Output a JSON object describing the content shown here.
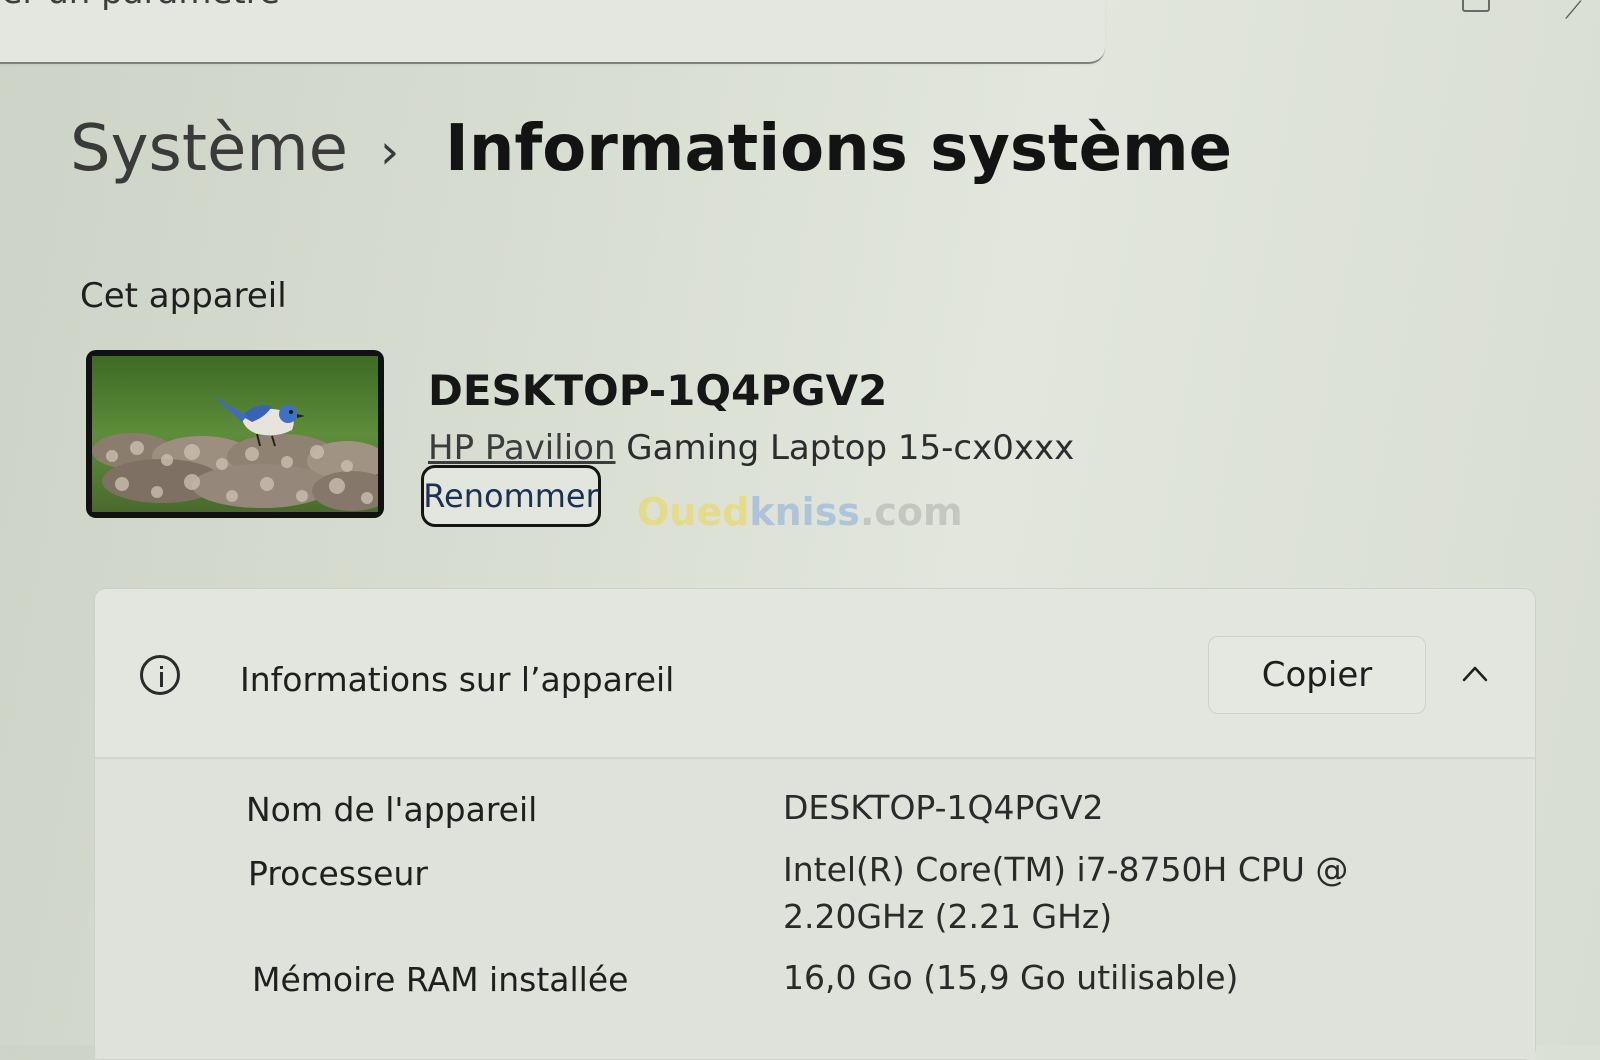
{
  "search": {
    "text": "her un paramètre"
  },
  "breadcrumb": {
    "parent": "Système",
    "separator": "›",
    "current": "Informations système"
  },
  "device_section": {
    "label": "Cet appareil",
    "name": "DESKTOP-1Q4PGV2",
    "model_link": "HP Pavilion",
    "model_rest": " Gaming Laptop 15-cx0xxx",
    "rename_label": "Renommer"
  },
  "watermark": {
    "part1": "Oued",
    "part2": "kniss",
    "part3": ".com"
  },
  "device_info": {
    "icon": "info-icon",
    "title": "Informations sur l’appareil",
    "copy_label": "Copier",
    "specs": [
      {
        "label": "Nom de l'appareil",
        "value": "DESKTOP-1Q4PGV2"
      },
      {
        "label": "Processeur",
        "value_line1": "Intel(R) Core(TM) i7-8750H CPU @",
        "value_line2": "2.20GHz (2.21 GHz)"
      },
      {
        "label": "Mémoire RAM installée",
        "value": "16,0 Go (15,9 Go utilisable)"
      }
    ]
  },
  "colors": {
    "background": "#d9ded2",
    "card": "#e3e6de",
    "rename_text": "#1c2f55"
  }
}
